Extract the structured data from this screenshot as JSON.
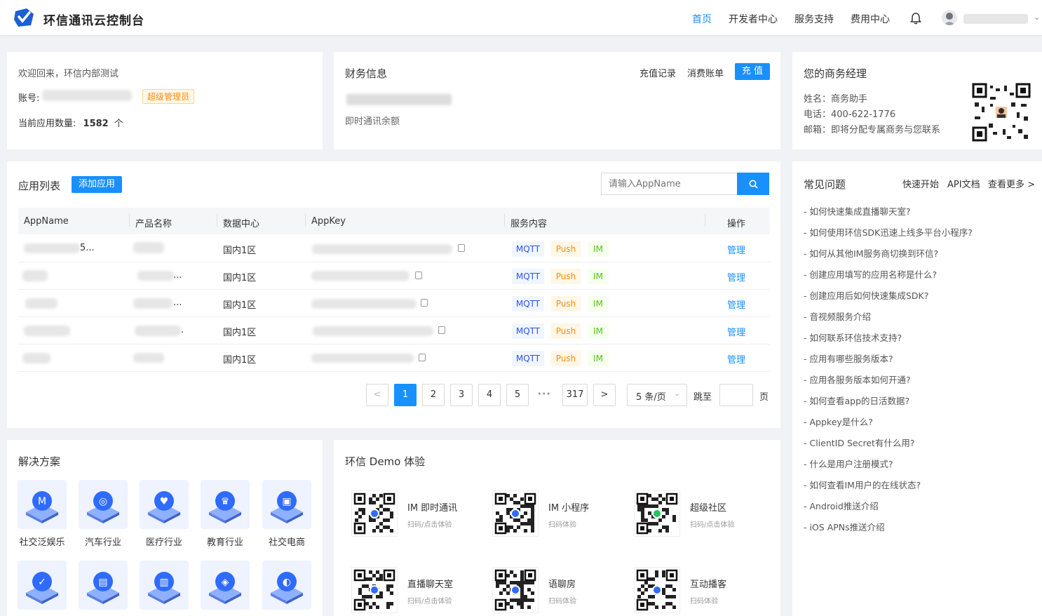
{
  "header": {
    "brand": "环信通讯云控制台",
    "nav": [
      "首页",
      "开发者中心",
      "服务支持",
      "费用中心"
    ],
    "active_nav": "首页",
    "icons": [
      "logo-icon",
      "bell-icon",
      "avatar-icon",
      "chevron-down-icon"
    ]
  },
  "welcome": {
    "greeting": "欢迎回来，环信内部测试",
    "account_label": "账号:",
    "role_tag": "超级管理员",
    "app_count_label": "当前应用数量:",
    "app_count": "1582",
    "app_count_unit": "个"
  },
  "finance": {
    "title": "财务信息",
    "recharge_record": "充值记录",
    "bill": "消费账单",
    "recharge_btn": "充 值",
    "balance_label": "即时通讯余额"
  },
  "manager": {
    "title": "您的商务经理",
    "name": "姓名：商务助手",
    "phone": "电话：400-622-1776",
    "email": "邮箱：即将分配专属商务与您联系"
  },
  "apps": {
    "title": "应用列表",
    "add_btn": "添加应用",
    "search_placeholder": "请输入AppName",
    "columns": [
      "AppName",
      "产品名称",
      "数据中心",
      "AppKey",
      "服务内容",
      "操作"
    ],
    "rows": [
      {
        "app_suffix": "5...",
        "product_suffix": "",
        "dc": "国内1区",
        "services": [
          "MQTT",
          "Push",
          "IM"
        ],
        "action": "管理"
      },
      {
        "app_suffix": "",
        "product_suffix": "...",
        "dc": "国内1区",
        "services": [
          "MQTT",
          "Push",
          "IM"
        ],
        "action": "管理"
      },
      {
        "app_suffix": "",
        "product_suffix": "...",
        "dc": "国内1区",
        "services": [
          "MQTT",
          "Push",
          "IM"
        ],
        "action": "管理"
      },
      {
        "app_suffix": "",
        "product_suffix": ".",
        "dc": "国内1区",
        "services": [
          "MQTT",
          "Push",
          "IM"
        ],
        "action": "管理"
      },
      {
        "app_suffix": "",
        "product_suffix": "",
        "dc": "国内1区",
        "services": [
          "MQTT",
          "Push",
          "IM"
        ],
        "action": "管理"
      }
    ],
    "pagination": {
      "prev": "<",
      "pages": [
        "1",
        "2",
        "3",
        "4",
        "5"
      ],
      "ellipsis": "•••",
      "last": "317",
      "next": ">",
      "current": "1",
      "page_size": "5 条/页",
      "jump_label": "跳至",
      "page_label": "页"
    }
  },
  "faq": {
    "title": "常见问题",
    "quick_start": "快速开始",
    "api_docs": "API文档",
    "more": "查看更多 >",
    "items": [
      "- 如何快速集成直播聊天室?",
      "- 如何使用环信SDK迅速上线多平台小程序?",
      "- 如何从其他IM服务商切换到环信?",
      "- 创建应用填写的应用名称是什么?",
      "- 创建应用后如何快速集成SDK?",
      "- 音视频服务介绍",
      "- 如何联系环信技术支持?",
      "- 应用有哪些服务版本?",
      "- 应用各服务版本如何开通?",
      "- 如何查看app的日活数据?",
      "- Appkey是什么?",
      "- ClientID Secret有什么用?",
      "- 什么是用户注册模式?",
      "- 如何查看IM用户的在线状态?",
      "- Android推送介绍",
      "- iOS APNs推送介绍"
    ]
  },
  "solutions": {
    "title": "解决方案",
    "items": [
      {
        "label": "社交泛娱乐",
        "icon": "microphone-icon"
      },
      {
        "label": "汽车行业",
        "icon": "steering-wheel-icon"
      },
      {
        "label": "医疗行业",
        "icon": "heart-icon"
      },
      {
        "label": "教育行业",
        "icon": "trophy-icon"
      },
      {
        "label": "社交电商",
        "icon": "shopping-bag-icon"
      },
      {
        "label": "",
        "icon": "gear-check-icon"
      },
      {
        "label": "",
        "icon": "id-card-icon"
      },
      {
        "label": "",
        "icon": "document-icon"
      },
      {
        "label": "",
        "icon": "gamepad-icon"
      },
      {
        "label": "",
        "icon": "planet-icon"
      }
    ]
  },
  "demo": {
    "title": "环信 Demo 体验",
    "items": [
      {
        "name": "IM 即时通讯",
        "sub": "扫码/点击体验"
      },
      {
        "name": "IM 小程序",
        "sub": "扫码体验"
      },
      {
        "name": "超级社区",
        "sub": "扫码/点击体验"
      },
      {
        "name": "直播聊天室",
        "sub": "扫码/点击体验"
      },
      {
        "name": "语聊房",
        "sub": "扫码体验"
      },
      {
        "name": "互动播客",
        "sub": "扫码体验"
      }
    ]
  },
  "colors": {
    "accent": "#1890ff",
    "mqtt": "#2f54eb",
    "push": "#fa8c16",
    "im": "#52c41a"
  }
}
